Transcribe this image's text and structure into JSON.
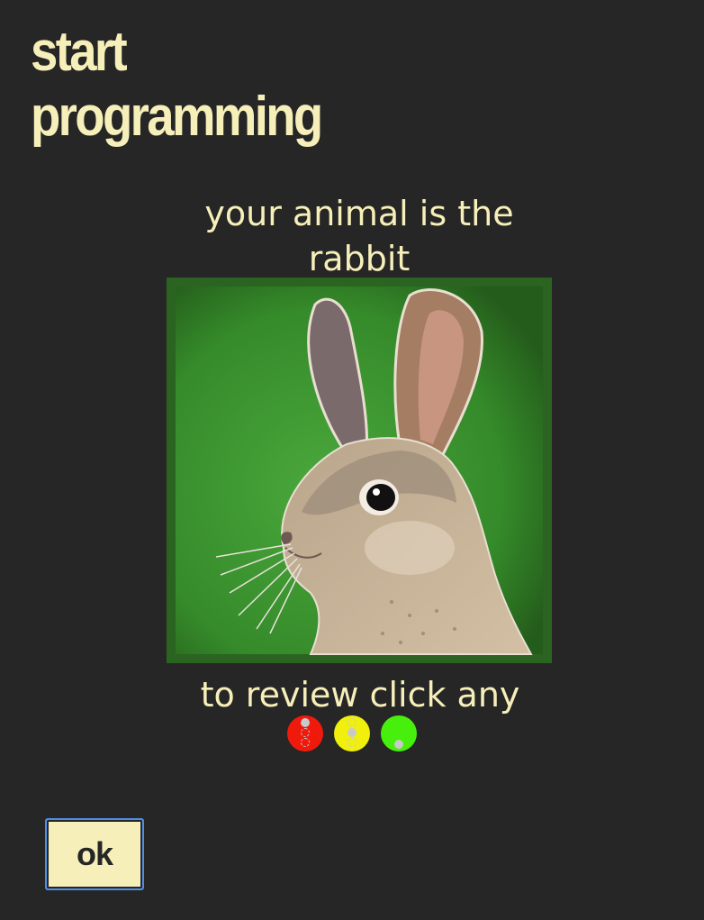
{
  "title": {
    "line1": "start",
    "line2": "programming"
  },
  "subtitle": {
    "line1": "your animal is the",
    "line2": "rabbit"
  },
  "animal": {
    "name": "rabbit",
    "icon": "rabbit-picture"
  },
  "review": {
    "text": "to review click any"
  },
  "dots": [
    {
      "color": "#f01a0c",
      "name": "red"
    },
    {
      "color": "#f0f00c",
      "name": "yellow"
    },
    {
      "color": "#47f00c",
      "name": "green"
    }
  ],
  "button": {
    "label": "ok"
  },
  "colors": {
    "background": "#262626",
    "text": "#f7efb9",
    "image_bg": "#2d6a20",
    "button_border": "#4f8ee8"
  }
}
